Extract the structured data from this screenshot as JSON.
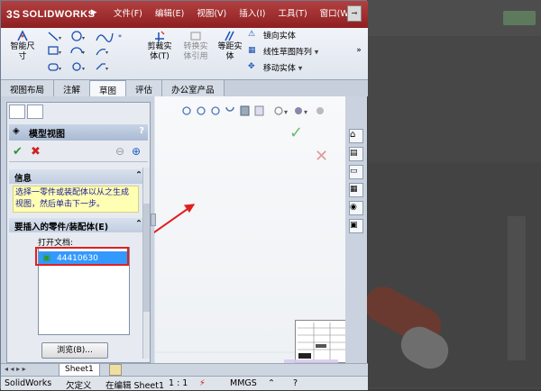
{
  "app": {
    "logo_text": "SOLIDWORKS",
    "logo_prefix": "3S"
  },
  "menu": [
    "文件(F)",
    "编辑(E)",
    "视图(V)",
    "插入(I)",
    "工具(T)",
    "窗口(W)"
  ],
  "ribbon": {
    "smart_dim": "智能尺\n寸",
    "cut_entity": "剪裁实\n体(T)",
    "convert_entity": "转换实\n体引用",
    "offset_entity": "等距实\n体",
    "mirror_entity": "镜向实体",
    "linear_pattern": "线性草图阵列",
    "move_entity": "移动实体"
  },
  "tabs": [
    "视图布局",
    "注解",
    "草图",
    "评估",
    "办公室产品"
  ],
  "active_tab": "草图",
  "panel": {
    "title": "模型视图",
    "help": "?",
    "info_header": "信息",
    "info_text": "选择一零件或装配体以从之生成视图，然后单击下一步。",
    "insert_header": "要插入的零件/装配体(E)",
    "open_docs_label": "打开文档:",
    "selected_doc": "44410630",
    "browse_button": "浏览(B)..."
  },
  "sheet_tab": "Sheet1",
  "status": {
    "app": "SolidWorks",
    "def": "欠定义",
    "editing": "在编辑 Sheet1",
    "scale": "1 : 1",
    "units": "MMGS"
  },
  "colors": {
    "titlebar": "#a83236",
    "selection": "#3399ff",
    "annotation": "#e02020",
    "info_bg": "#ffffb3"
  }
}
